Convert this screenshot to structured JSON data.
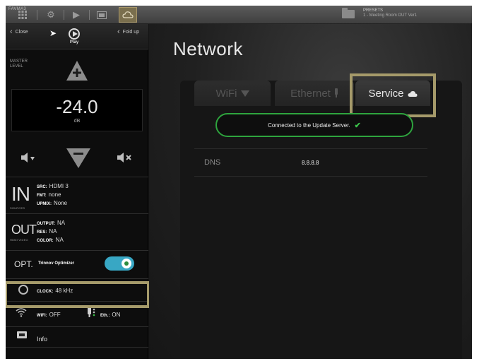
{
  "toolbar": {
    "label": "FAVMA3",
    "items": [
      "grid-icon",
      "settings-icon",
      "play-icon",
      "window-icon",
      "cloud-icon"
    ]
  },
  "preset": {
    "title": "PRESETS",
    "name": "1 - Meeting Room OUT Ver1"
  },
  "sidebar": {
    "close_label": "Close",
    "play_label": "Play",
    "fold_label": "Fold up",
    "master_level_label": "MASTER LEVEL",
    "level_value": "-24.0",
    "level_unit": "dB",
    "in": {
      "letter": "IN",
      "sub": "SOURCES",
      "src_key": "SRC:",
      "src_val": "HDMI 3",
      "fmt_key": "FMT:",
      "fmt_val": "none",
      "upmix_key": "UPMIX:",
      "upmix_val": "None"
    },
    "out": {
      "letter": "OUT",
      "sub": "HDMI VIDEO",
      "output_key": "OUTPUT:",
      "output_val": "NA",
      "res_key": "RES:",
      "res_val": "NA",
      "color_key": "COLOR:",
      "color_val": "NA"
    },
    "opt": {
      "label": "OPT.",
      "name": "Trinnov Optimizer",
      "enabled": true
    },
    "clock": {
      "key": "CLOCK:",
      "val": "48 kHz"
    },
    "network": {
      "wifi_key": "WiFi:",
      "wifi_val": "OFF",
      "eth_key": "Eth.:",
      "eth_val": "ON"
    },
    "info_label": "Info"
  },
  "main": {
    "title": "Network",
    "tabs": [
      {
        "label": "WiFi",
        "icon": "wifi-icon"
      },
      {
        "label": "Ethernet",
        "icon": "ethernet-icon"
      },
      {
        "label": "Service",
        "icon": "cloud-icon"
      }
    ],
    "active_tab": "Service",
    "status_text": "Connected to the Update Server.",
    "dns_label": "DNS",
    "dns_value": "8.8.8.8"
  },
  "colors": {
    "accent": "#38a7c4",
    "success": "#2ea43e",
    "highlight": "#a59a6a"
  }
}
